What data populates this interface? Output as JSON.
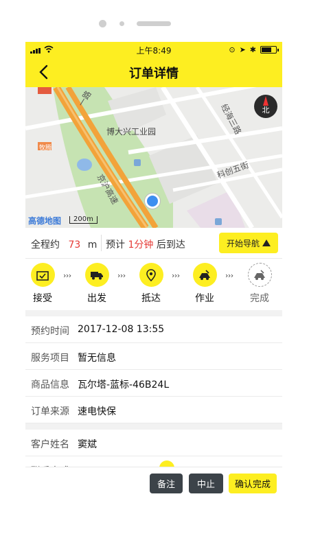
{
  "status": {
    "time": "上午8:49"
  },
  "header": {
    "title": "订单详情"
  },
  "map": {
    "labels": {
      "road_top": "一路",
      "poi": "博大兴工业园",
      "highway": "京沪高速",
      "road_right": "经海三路",
      "road_street": "科创五街",
      "corner_poi": "牧腾"
    },
    "compass_label": "北",
    "provider": "高德地图",
    "scale": "200m"
  },
  "route": {
    "total_label": "全程约",
    "distance": "73",
    "distance_unit": "m",
    "eta_label": "预计",
    "eta_value": "1分钟",
    "eta_suffix": "后到达",
    "nav_button": "开始导航"
  },
  "steps": [
    {
      "label": "接受",
      "icon": "accept-icon",
      "done": true
    },
    {
      "label": "出发",
      "icon": "truck-icon",
      "done": true
    },
    {
      "label": "抵达",
      "icon": "location-pin-icon",
      "done": true
    },
    {
      "label": "作业",
      "icon": "work-icon",
      "done": true
    },
    {
      "label": "完成",
      "icon": "complete-icon",
      "done": false
    }
  ],
  "order": {
    "rows": [
      {
        "key": "预约时间",
        "value": "2017-12-08 13:55"
      },
      {
        "key": "服务项目",
        "value": "暂无信息"
      },
      {
        "key": "商品信息",
        "value": "瓦尔塔-蓝标-46B24L"
      },
      {
        "key": "订单来源",
        "value": "速电快保"
      }
    ],
    "customer": [
      {
        "key": "客户姓名",
        "value": "窦斌"
      },
      {
        "key": "联系方式",
        "value": ""
      }
    ]
  },
  "actions": {
    "note": "备注",
    "abort": "中止",
    "confirm": "确认完成"
  },
  "colors": {
    "accent": "#fdee21",
    "dark_button": "#3c4349",
    "highlight": "#e53935"
  }
}
